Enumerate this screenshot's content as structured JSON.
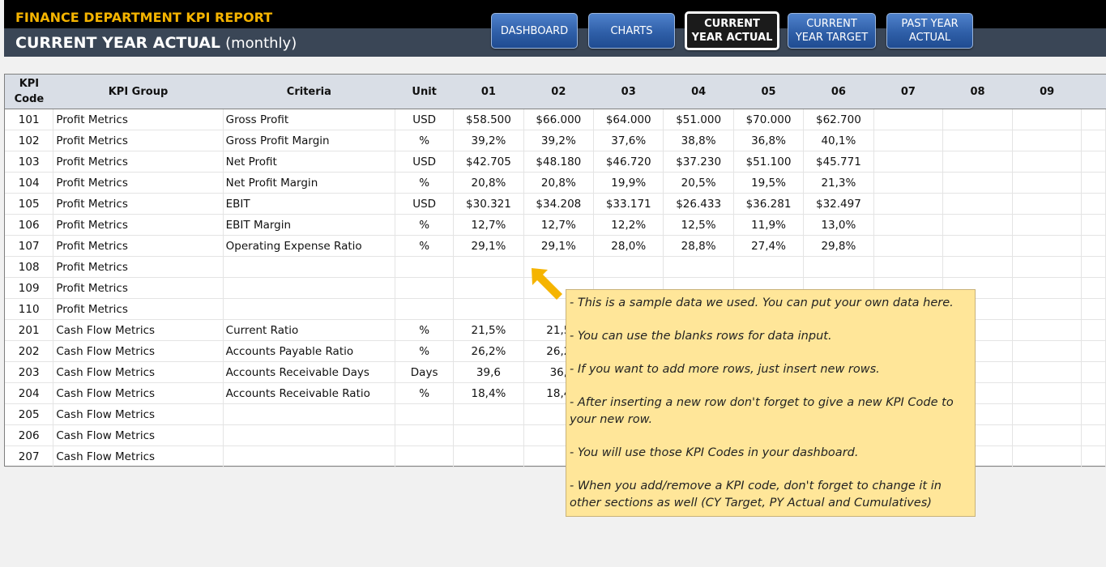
{
  "header": {
    "title": "FINANCE DEPARTMENT KPI REPORT",
    "subtitle_main": "CURRENT YEAR ACTUAL",
    "subtitle_suffix": "(monthly)"
  },
  "nav": {
    "dashboard": "DASHBOARD",
    "charts": "CHARTS",
    "cy_actual": "CURRENT YEAR ACTUAL",
    "cy_target": "CURRENT YEAR TARGET",
    "py_actual": "PAST YEAR ACTUAL"
  },
  "table": {
    "headers": [
      "KPI Code",
      "KPI Group",
      "Criteria",
      "Unit",
      "01",
      "02",
      "03",
      "04",
      "05",
      "06",
      "07",
      "08",
      "09"
    ],
    "rows": [
      [
        "101",
        "Profit Metrics",
        "Gross Profit",
        "USD",
        "$58.500",
        "$66.000",
        "$64.000",
        "$51.000",
        "$70.000",
        "$62.700",
        "",
        "",
        "",
        ""
      ],
      [
        "102",
        "Profit Metrics",
        "Gross Profit Margin",
        "%",
        "39,2%",
        "39,2%",
        "37,6%",
        "38,8%",
        "36,8%",
        "40,1%",
        "",
        "",
        "",
        ""
      ],
      [
        "103",
        "Profit Metrics",
        "Net Profit",
        "USD",
        "$42.705",
        "$48.180",
        "$46.720",
        "$37.230",
        "$51.100",
        "$45.771",
        "",
        "",
        "",
        ""
      ],
      [
        "104",
        "Profit Metrics",
        "Net Profit Margin",
        "%",
        "20,8%",
        "20,8%",
        "19,9%",
        "20,5%",
        "19,5%",
        "21,3%",
        "",
        "",
        "",
        ""
      ],
      [
        "105",
        "Profit Metrics",
        "EBIT",
        "USD",
        "$30.321",
        "$34.208",
        "$33.171",
        "$26.433",
        "$36.281",
        "$32.497",
        "",
        "",
        "",
        ""
      ],
      [
        "106",
        "Profit Metrics",
        "EBIT Margin",
        "%",
        "12,7%",
        "12,7%",
        "12,2%",
        "12,5%",
        "11,9%",
        "13,0%",
        "",
        "",
        "",
        ""
      ],
      [
        "107",
        "Profit Metrics",
        "Operating Expense Ratio",
        "%",
        "29,1%",
        "29,1%",
        "28,0%",
        "28,8%",
        "27,4%",
        "29,8%",
        "",
        "",
        "",
        ""
      ],
      [
        "108",
        "Profit Metrics",
        "",
        "",
        "",
        "",
        "",
        "",
        "",
        "",
        "",
        "",
        "",
        ""
      ],
      [
        "109",
        "Profit Metrics",
        "",
        "",
        "",
        "",
        "",
        "",
        "",
        "",
        "",
        "",
        "",
        ""
      ],
      [
        "110",
        "Profit Metrics",
        "",
        "",
        "",
        "",
        "",
        "",
        "",
        "",
        "",
        "",
        "",
        ""
      ],
      [
        "201",
        "Cash Flow Metrics",
        "Current Ratio",
        "%",
        "21,5%",
        "21,5",
        "",
        "",
        "",
        "",
        "",
        "",
        "",
        ""
      ],
      [
        "202",
        "Cash Flow Metrics",
        "Accounts Payable Ratio",
        "%",
        "26,2%",
        "26,2",
        "",
        "",
        "",
        "",
        "",
        "",
        "",
        ""
      ],
      [
        "203",
        "Cash Flow Metrics",
        "Accounts Receivable Days",
        "Days",
        "39,6",
        "36,",
        "",
        "",
        "",
        "",
        "",
        "",
        "",
        ""
      ],
      [
        "204",
        "Cash Flow Metrics",
        "Accounts Receivable Ratio",
        "%",
        "18,4%",
        "18,4",
        "",
        "",
        "",
        "",
        "",
        "",
        "",
        ""
      ],
      [
        "205",
        "Cash Flow Metrics",
        "",
        "",
        "",
        "",
        "",
        "",
        "",
        "",
        "",
        "",
        "",
        ""
      ],
      [
        "206",
        "Cash Flow Metrics",
        "",
        "",
        "",
        "",
        "",
        "",
        "",
        "",
        "",
        "",
        "",
        ""
      ],
      [
        "207",
        "Cash Flow Metrics",
        "",
        "",
        "",
        "",
        "",
        "",
        "",
        "",
        "",
        "",
        "",
        ""
      ]
    ]
  },
  "note": {
    "lines": [
      "- This is a sample data we used. You can put your own data here.",
      "- You can use the blanks rows for data input.",
      "- If you want to add more rows, just insert new rows.",
      "- After inserting a new row don't forget to give a new KPI Code to your new row.",
      "- You will use those KPI Codes in your dashboard.",
      "- When you add/remove a KPI code, don't forget to change it in other sections as well (CY Target, PY Actual and Cumulatives)"
    ]
  },
  "colors": {
    "title": "#f5b400",
    "header_bar": "#3a4656",
    "button": "#2f5fa8",
    "note_bg": "#ffe699",
    "arrow": "#f5b400"
  },
  "icons": {
    "arrow": "arrow-up-left-icon"
  }
}
